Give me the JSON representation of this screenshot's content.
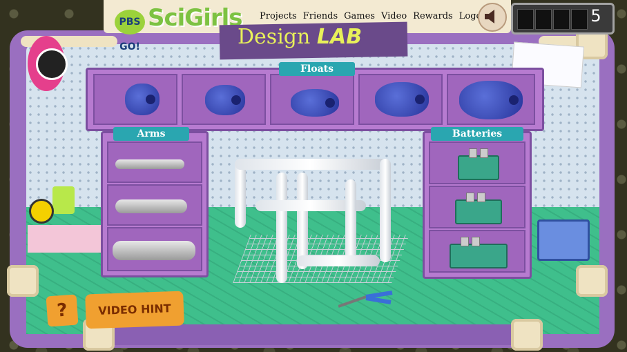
{
  "logos": {
    "pbs": "PBS GO!",
    "scigirls": "SciGirls"
  },
  "nav": {
    "items": [
      "Projects",
      "Friends",
      "Games",
      "Video",
      "Rewards",
      "Logout"
    ]
  },
  "counter": {
    "value": "5"
  },
  "title": {
    "part1": "Design",
    "part2": "LAB"
  },
  "shelves": {
    "floats": "Floats",
    "arms": "Arms",
    "batteries": "Batteries"
  },
  "buttons": {
    "help": "?",
    "video_hint": "VIDEO HINT"
  },
  "colors": {
    "frame": "#9a6fc0",
    "shelf": "#b77bd0",
    "label": "#2aa6b0",
    "floor": "#3fbf8c",
    "button": "#f0a030"
  }
}
